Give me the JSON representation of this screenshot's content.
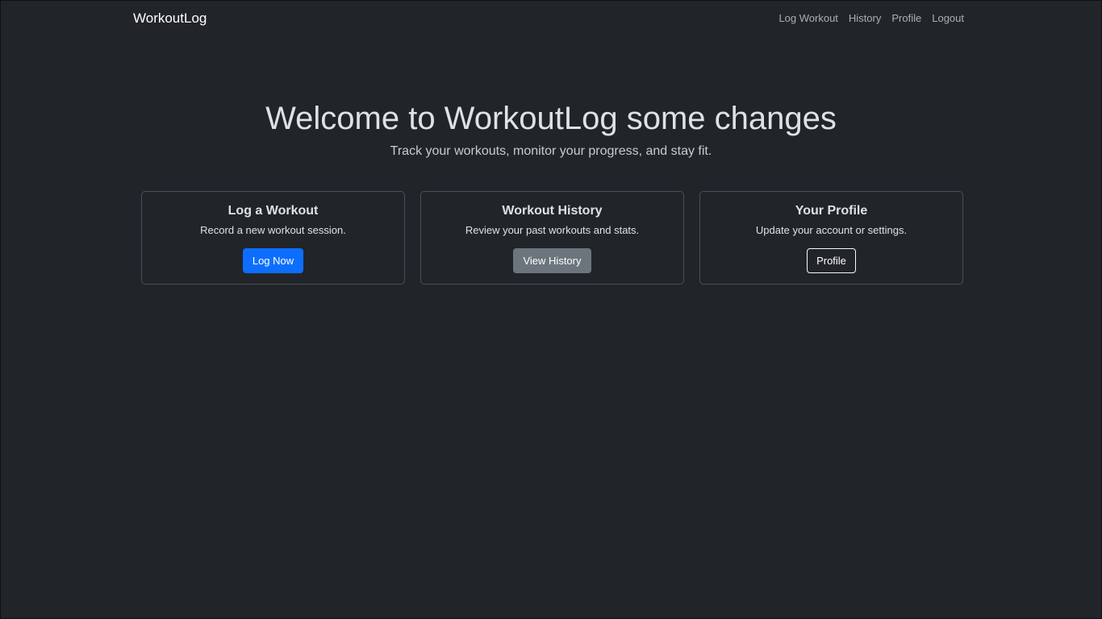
{
  "navbar": {
    "brand": "WorkoutLog",
    "links": [
      "Log Workout",
      "History",
      "Profile",
      "Logout"
    ]
  },
  "hero": {
    "title": "Welcome to WorkoutLog some changes",
    "subtitle": "Track your workouts, monitor your progress, and stay fit."
  },
  "cards": [
    {
      "title": "Log a Workout",
      "description": "Record a new workout session.",
      "button": "Log Now"
    },
    {
      "title": "Workout History",
      "description": "Review your past workouts and stats.",
      "button": "View History"
    },
    {
      "title": "Your Profile",
      "description": "Update your account or settings.",
      "button": "Profile"
    }
  ],
  "colors": {
    "background": "#212529",
    "primary": "#0d6efd",
    "secondary": "#6c757d"
  }
}
